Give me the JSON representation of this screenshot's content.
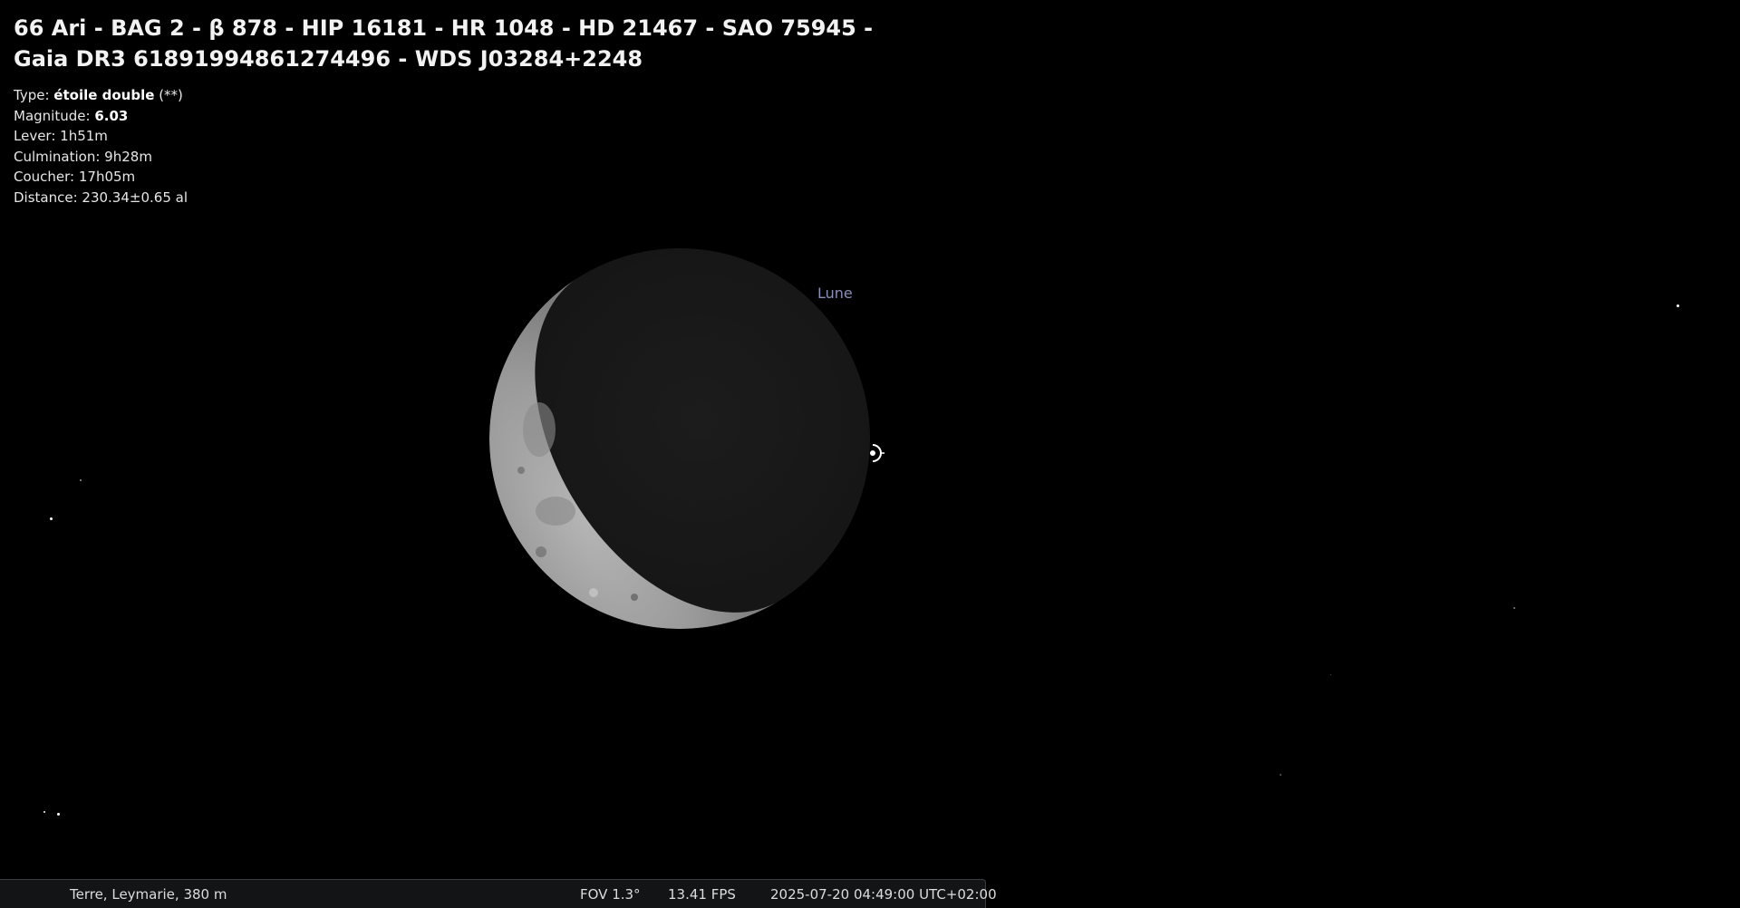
{
  "object": {
    "title_line1": "66 Ari - BAG 2 - β 878 - HIP 16181 - HR 1048 - HD 21467 - SAO 75945 -",
    "title_line2": "Gaia DR3 61891994861274496 - WDS J03284+2248",
    "type_label": "Type:",
    "type_value": "étoile double",
    "type_suffix": "(**)",
    "magnitude_label": "Magnitude:",
    "magnitude_value": "6.03",
    "rise": "Lever: 1h51m",
    "transit": "Culmination: 9h28m",
    "set": "Coucher: 17h05m",
    "distance": "Distance: 230.34±0.65 al"
  },
  "sky": {
    "moon_label": "Lune",
    "moon_phase": "waning crescent",
    "marker_icon": "selection-marker-icon"
  },
  "statusbar": {
    "location": "Terre, Leymarie, 380 m",
    "fov": "FOV 1.3°",
    "fps": "13.41 FPS",
    "datetime": "2025-07-20 04:49:00 UTC+02:00"
  },
  "colors": {
    "background": "#000000",
    "label_color": "#8a8fb8",
    "statusbar_bg": "#121416"
  }
}
